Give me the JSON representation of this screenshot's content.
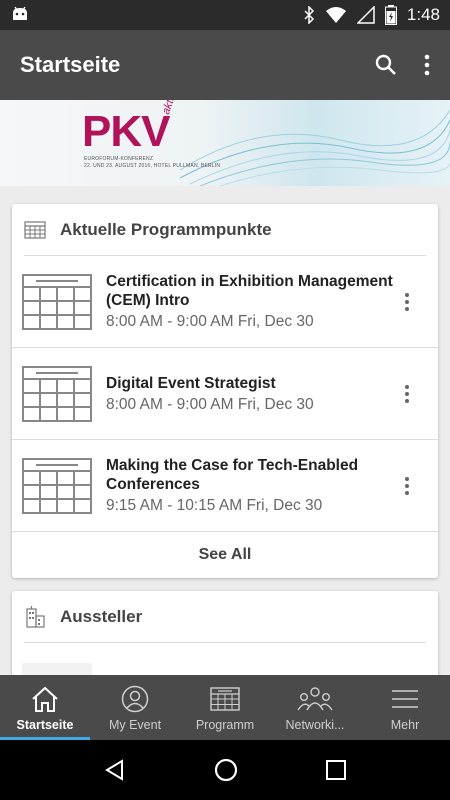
{
  "status_bar": {
    "time": "1:48"
  },
  "app_bar": {
    "title": "Startseite"
  },
  "banner": {
    "logo": "PKV",
    "logo_sub": "aktuell",
    "tagline_1": "EUROFORUM-KONFERENZ",
    "tagline_2": "22. UND 23. AUGUST 2016, HOTEL PULLMAN, BERLIN"
  },
  "program_card": {
    "title": "Aktuelle Programmpunkte",
    "sessions": [
      {
        "title": "Certification in Exhibition Management (CEM) Intro",
        "time": "8:00 AM - 9:00 AM Fri, Dec 30"
      },
      {
        "title": "Digital Event Strategist",
        "time": "8:00 AM - 9:00 AM Fri, Dec 30"
      },
      {
        "title": "Making the Case for Tech-Enabled Conferences",
        "time": "9:15 AM - 10:15 AM Fri, Dec 30"
      }
    ],
    "see_all": "See All"
  },
  "exhibitor_card": {
    "title": "Aussteller"
  },
  "bottom_nav": [
    {
      "label": "Startseite",
      "icon": "home-icon",
      "active": true
    },
    {
      "label": "My Event",
      "icon": "person-icon",
      "active": false
    },
    {
      "label": "Programm",
      "icon": "calendar-icon",
      "active": false
    },
    {
      "label": "Networki...",
      "icon": "people-icon",
      "active": false
    },
    {
      "label": "Mehr",
      "icon": "menu-icon",
      "active": false
    }
  ],
  "colors": {
    "app_bar": "#4a4a4a",
    "accent": "#3fa9e6",
    "logo": "#b0135a"
  }
}
